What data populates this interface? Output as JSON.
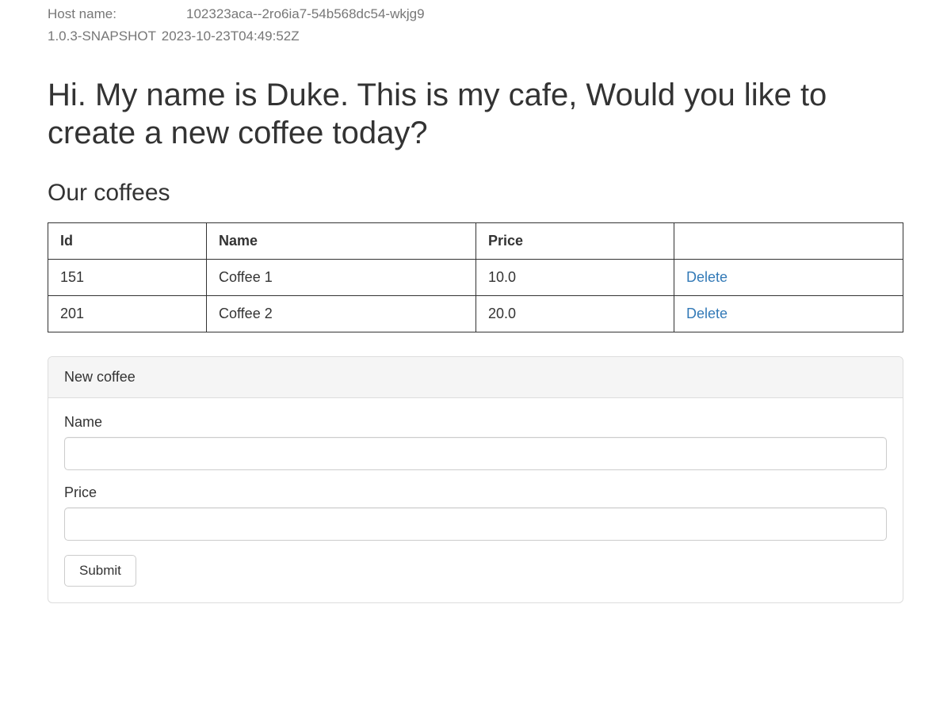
{
  "meta": {
    "hostname_label": "Host name:",
    "hostname": "102323aca--2ro6ia7-54b568dc54-wkjg9",
    "version": "1.0.3-SNAPSHOT",
    "build_time": "2023-10-23T04:49:52Z"
  },
  "page_title": "Hi. My name is Duke. This is my cafe, Would you like to create a new coffee today?",
  "coffees_heading": "Our coffees",
  "table": {
    "headers": {
      "id": "Id",
      "name": "Name",
      "price": "Price",
      "action": ""
    },
    "rows": [
      {
        "id": "151",
        "name": "Coffee 1",
        "price": "10.0",
        "delete": "Delete"
      },
      {
        "id": "201",
        "name": "Coffee 2",
        "price": "20.0",
        "delete": "Delete"
      }
    ]
  },
  "form": {
    "panel_title": "New coffee",
    "name_label": "Name",
    "name_value": "",
    "price_label": "Price",
    "price_value": "",
    "submit_label": "Submit"
  }
}
